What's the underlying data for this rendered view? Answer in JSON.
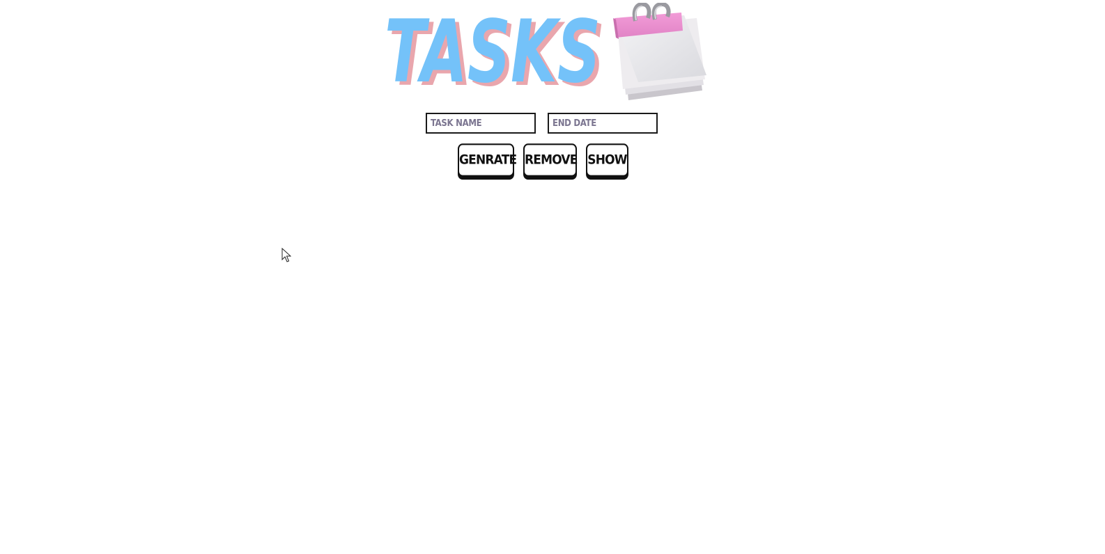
{
  "header": {
    "title": "TASKS",
    "logo_icon": "calendar-icon",
    "colors": {
      "title_fill": "#74c2f9",
      "title_shadow": "#e9a6ad",
      "calendar_top": "#ec8ecf"
    }
  },
  "form": {
    "task_name_placeholder": "TASK NAME",
    "task_name_value": "",
    "end_date_placeholder": "END DATE",
    "end_date_value": ""
  },
  "buttons": {
    "generate_label": "GENRATE",
    "remove_label": "REMOVE",
    "show_label": "SHOW"
  },
  "cursor": {
    "icon": "mouse-pointer-icon"
  }
}
